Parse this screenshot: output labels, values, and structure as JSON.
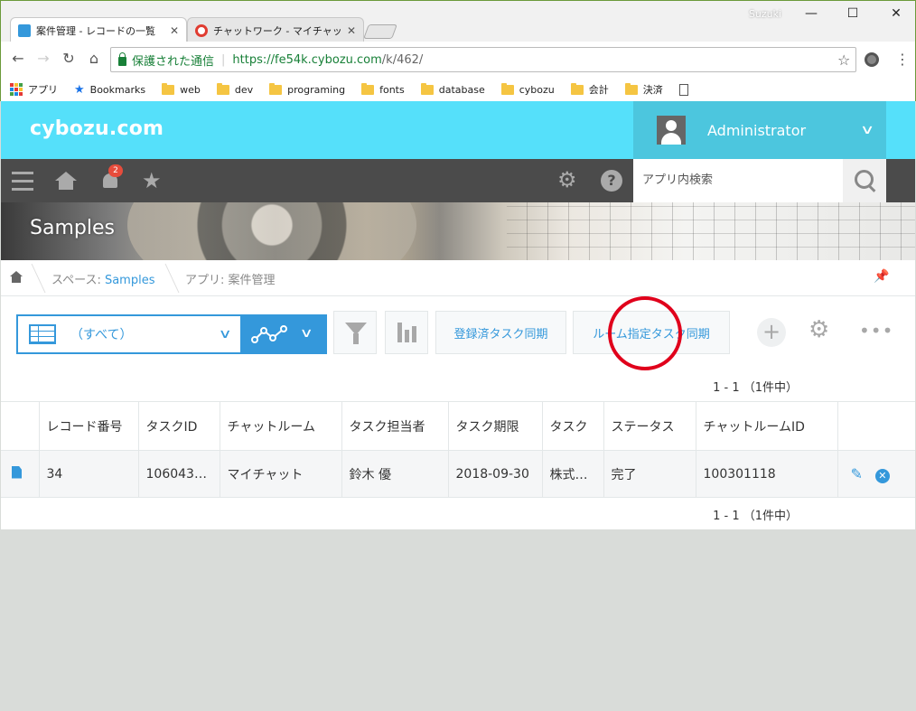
{
  "browser": {
    "tabs": [
      {
        "title": "案件管理 - レコードの一覧",
        "favicon_color": "#3498db"
      },
      {
        "title": "チャットワーク - マイチャット",
        "favicon_color": "#e03c31"
      }
    ],
    "user": "Suzuki",
    "window_controls": {
      "minimize": "—",
      "maximize": "☐",
      "close": "✕"
    },
    "secure_label": "保護された通信",
    "url_scheme_host": "https://fe54k.cybozu.com",
    "url_path": "/k/462/",
    "bookmarks": [
      "アプリ",
      "Bookmarks",
      "web",
      "dev",
      "programing",
      "fonts",
      "database",
      "cybozu",
      "会計",
      "決済"
    ]
  },
  "header": {
    "logo": "cybozu.com",
    "user_name": "Administrator",
    "notification_count": "2",
    "search_placeholder": "アプリ内検索"
  },
  "banner": {
    "title": "Samples"
  },
  "breadcrumb": {
    "space_label": "スペース: ",
    "space_name": "Samples",
    "app_label": "アプリ: 案件管理"
  },
  "toolbar": {
    "view_label": "（すべて）",
    "btn_registered_sync": "登録済タスク同期",
    "btn_room_sync": "ルーム指定タスク同期",
    "plus": "+",
    "more": "•••"
  },
  "pager": {
    "text": "1 - 1 （1件中）"
  },
  "table": {
    "columns": [
      "レコード番号",
      "タスクID",
      "チャットルーム",
      "タスク担当者",
      "タスク期限",
      "タスク",
      "ステータス",
      "チャットルームID"
    ],
    "rows": [
      [
        "34",
        "106043…",
        "マイチャット",
        "鈴木 優",
        "2018-09-30",
        "株式…",
        "完了",
        "100301118"
      ]
    ]
  },
  "colors": {
    "accent": "#3498db",
    "header": "#55e0fa",
    "bar": "#4b4b4b",
    "highlight": "#e0001b"
  }
}
